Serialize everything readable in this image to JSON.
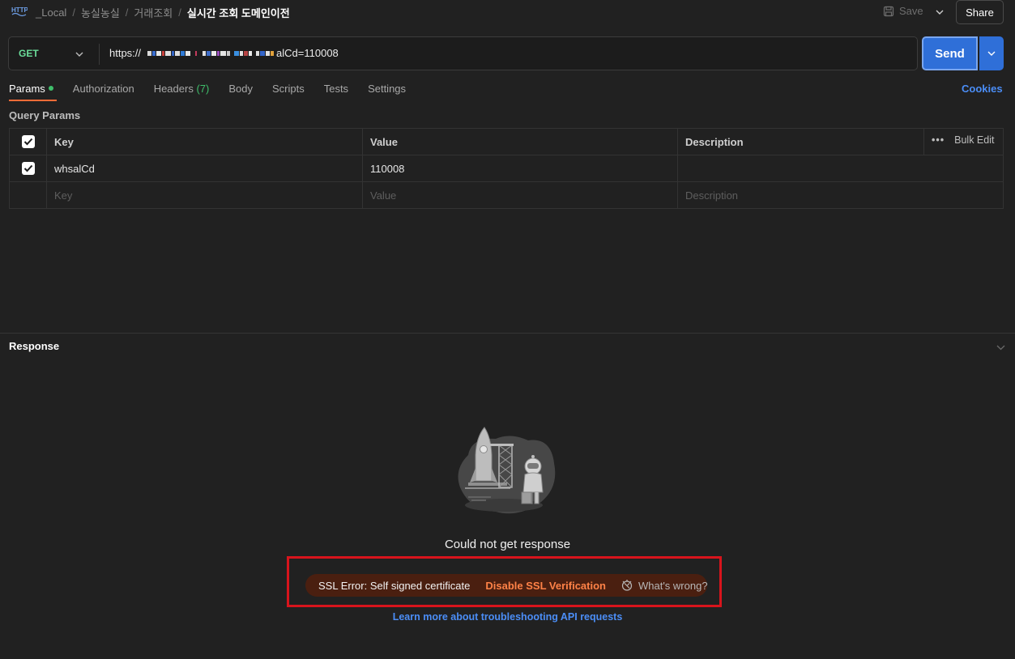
{
  "breadcrumb": {
    "items": [
      "_Local",
      "농실농실",
      "거래조회"
    ],
    "current": "실시간 조회 도메인이전",
    "separator": "/"
  },
  "toolbar": {
    "save_label": "Save",
    "share_label": "Share"
  },
  "request": {
    "method": "GET",
    "url_prefix": "https://",
    "url_suffix": "alCd=110008",
    "send_label": "Send"
  },
  "tabs": [
    {
      "label": "Params"
    },
    {
      "label": "Authorization"
    },
    {
      "label": "Headers",
      "count": "(7)"
    },
    {
      "label": "Body"
    },
    {
      "label": "Scripts"
    },
    {
      "label": "Tests"
    },
    {
      "label": "Settings"
    }
  ],
  "cookies_label": "Cookies",
  "query_params": {
    "title": "Query Params",
    "headers": {
      "key": "Key",
      "value": "Value",
      "description": "Description"
    },
    "bulk_edit_label": "Bulk Edit",
    "rows": [
      {
        "checked": true,
        "key": "whsalCd",
        "value": "110008",
        "description": ""
      }
    ],
    "placeholders": {
      "key": "Key",
      "value": "Value",
      "description": "Description"
    }
  },
  "response": {
    "title": "Response",
    "message": "Could not get response",
    "error_text": "SSL Error: Self signed certificate",
    "disable_ssl_label": "Disable SSL Verification",
    "whats_wrong_label": "What's wrong?",
    "learn_more_label": "Learn more about troubleshooting API requests"
  },
  "colors": {
    "background": "#212121",
    "accent_send": "#2f6fd8",
    "method_get": "#6bdd9a",
    "active_tab_underline": "#ff6c37",
    "link": "#4b8ef7",
    "error_pill": "#4a1f10",
    "error_action": "#ff8247",
    "highlight_outline": "#d8141c"
  },
  "icons": [
    "http-icon",
    "save-icon",
    "chevron-down-icon",
    "checkbox-checked-icon",
    "more-dots-icon",
    "rocket-astronaut-illustration",
    "debug-icon"
  ]
}
